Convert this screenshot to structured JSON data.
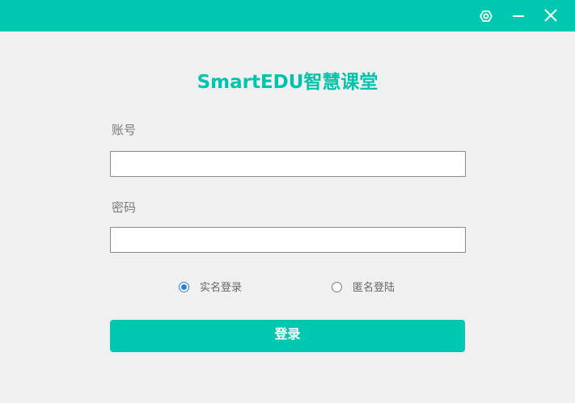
{
  "colors": {
    "accent": "#00c8b0",
    "title_text": "#00c3ad",
    "background": "#f0f0f0",
    "radio_selected": "#2f7fd8"
  },
  "titlebar": {
    "icons": [
      "settings-icon",
      "minimize-icon",
      "close-icon"
    ]
  },
  "app_title": "SmartEDU智慧课堂",
  "form": {
    "account_label": "账号",
    "account_value": "",
    "password_label": "密码",
    "password_value": ""
  },
  "login_mode": {
    "options": [
      {
        "label": "实名登录",
        "selected": true
      },
      {
        "label": "匿名登陆",
        "selected": false
      }
    ]
  },
  "login_button_label": "登录"
}
